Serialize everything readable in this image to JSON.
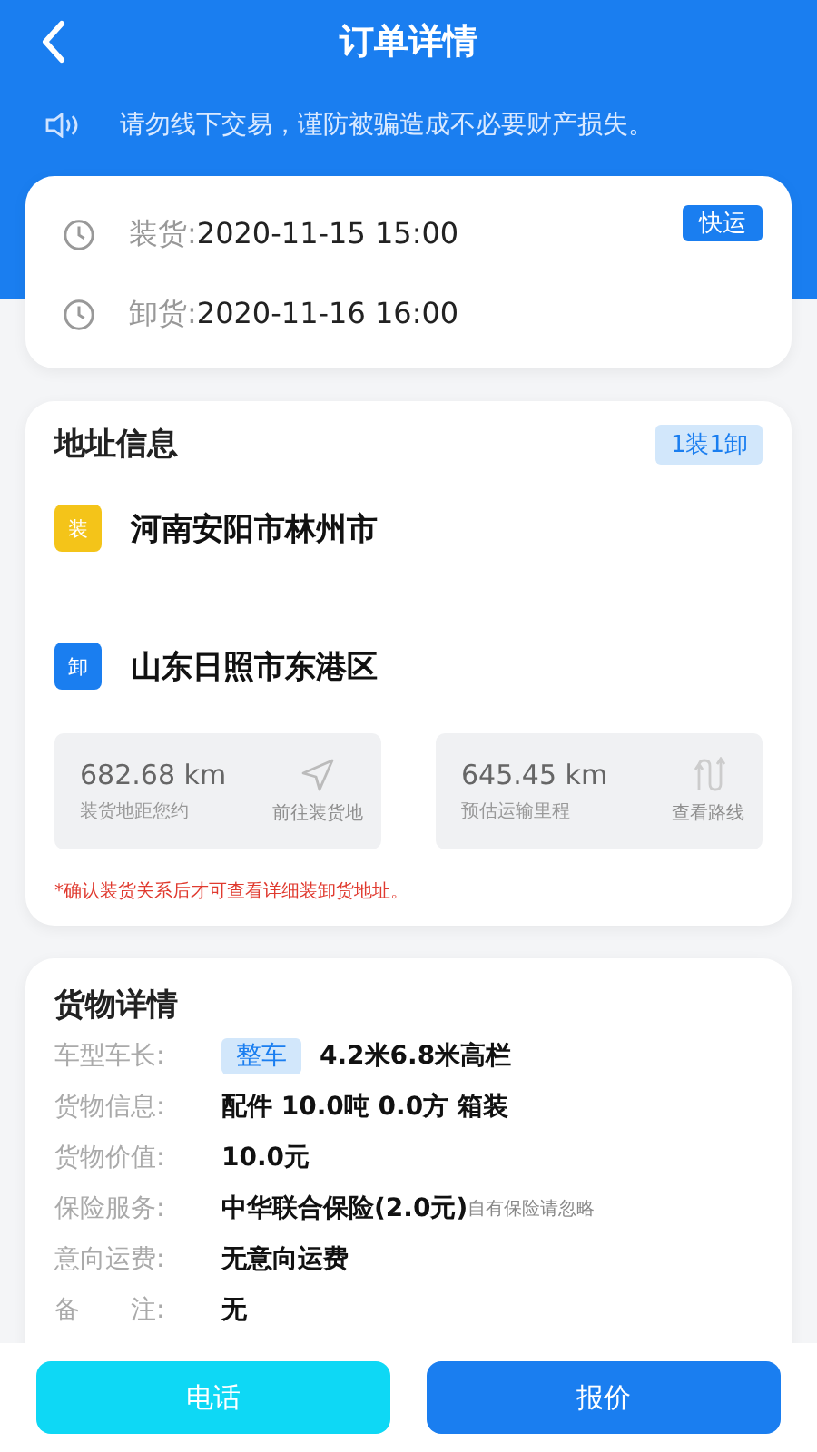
{
  "header": {
    "title": "订单详情"
  },
  "notice": {
    "text": "请勿线下交易，谨防被骗造成不必要财产损失。"
  },
  "schedule": {
    "tag": "快运",
    "rows": [
      {
        "label": "装货:",
        "value": "2020-11-15 15:00"
      },
      {
        "label": "卸货:",
        "value": "2020-11-16 16:00"
      }
    ]
  },
  "address": {
    "title": "地址信息",
    "badge": "1装1卸",
    "stops": [
      {
        "kind": "load",
        "tag": "装",
        "place": "河南安阳市林州市"
      },
      {
        "kind": "unload",
        "tag": "卸",
        "place": "山东日照市东港区"
      }
    ],
    "distances": [
      {
        "kind": "navigate",
        "value": "682.68 km",
        "caption": "装货地距您约",
        "action": "前往装货地"
      },
      {
        "kind": "route",
        "value": "645.45 km",
        "caption": "预估运输里程",
        "action": "查看路线"
      }
    ],
    "note": "*确认装货关系后才可查看详细装卸货地址。"
  },
  "cargo": {
    "title": "货物详情",
    "rows": [
      {
        "label": "车型车长:",
        "tag": "整车",
        "value": "4.2米6.8米高栏"
      },
      {
        "label": "货物信息:",
        "value": "配件 10.0吨 0.0方 箱装"
      },
      {
        "label": "货物价值:",
        "value": "10.0元"
      },
      {
        "label": "保险服务:",
        "value": "中华联合保险(2.0元)",
        "extra": "自有保险请忽略"
      },
      {
        "label": "意向运费:",
        "value": "无意向运费"
      },
      {
        "label": "备　　注:",
        "value": "无"
      }
    ]
  },
  "buttons": [
    {
      "kind": "secondary",
      "label": "电话"
    },
    {
      "kind": "primary",
      "label": "报价"
    }
  ]
}
